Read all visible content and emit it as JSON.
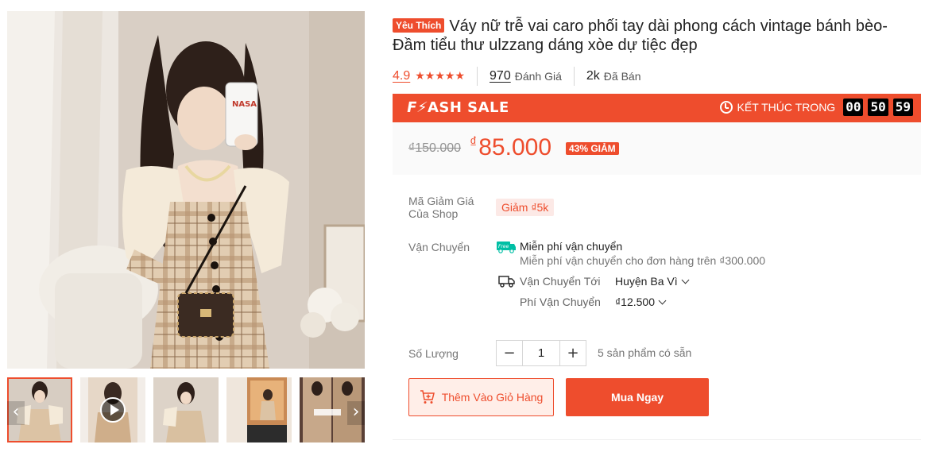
{
  "product": {
    "badge": "Yêu Thích",
    "title": "Váy nữ trễ vai caro phối tay dài phong cách vintage bánh bèo- Đầm tiểu thư ulzzang dáng xòe dự tiệc đẹp"
  },
  "rating": {
    "score": "4.9",
    "stars": "★★★★★",
    "stars_value": 4.9,
    "review_count": "970",
    "review_label": "Đánh Giá",
    "sold_count": "2k",
    "sold_label": "Đã Bán"
  },
  "flash_sale": {
    "logo_bolt": "F⚡",
    "logo_text": "ASH SALE",
    "ends_label": "KẾT THÚC TRONG",
    "hours": "00",
    "minutes": "50",
    "seconds": "59"
  },
  "price": {
    "original": "₫150.000",
    "currency": "₫",
    "current": "85.000",
    "discount": "43% GIẢM"
  },
  "voucher": {
    "label": "Mã Giảm Giá Của Shop",
    "tag": "Giảm ₫5k"
  },
  "shipping": {
    "label": "Vận Chuyển",
    "free_icon_text": "Free",
    "free_title": "Miễn phí vận chuyển",
    "free_desc": "Miễn phí vận chuyển cho đơn hàng trên ₫300.000",
    "to_label": "Vận Chuyển Tới",
    "to_value": "Huyện Ba Vì",
    "fee_label": "Phí Vận Chuyển",
    "fee_value": "₫12.500"
  },
  "quantity": {
    "label": "Số Lượng",
    "minus": "−",
    "value": "1",
    "plus": "+",
    "stock": "5 sản phẩm có sẵn"
  },
  "actions": {
    "add_to_cart": "Thêm Vào Giỏ Hàng",
    "buy_now": "Mua Ngay"
  },
  "gallery": {
    "prev": "‹",
    "next": "›",
    "thumbnails": [
      "photo-1",
      "video-2",
      "photo-3",
      "photo-4",
      "photo-5"
    ],
    "active_index": 0
  },
  "colors": {
    "accent": "#ee4d2d",
    "price_bg": "#fafafa",
    "voucher_bg": "#fce9e6",
    "cart_bg": "#ffeee8"
  }
}
